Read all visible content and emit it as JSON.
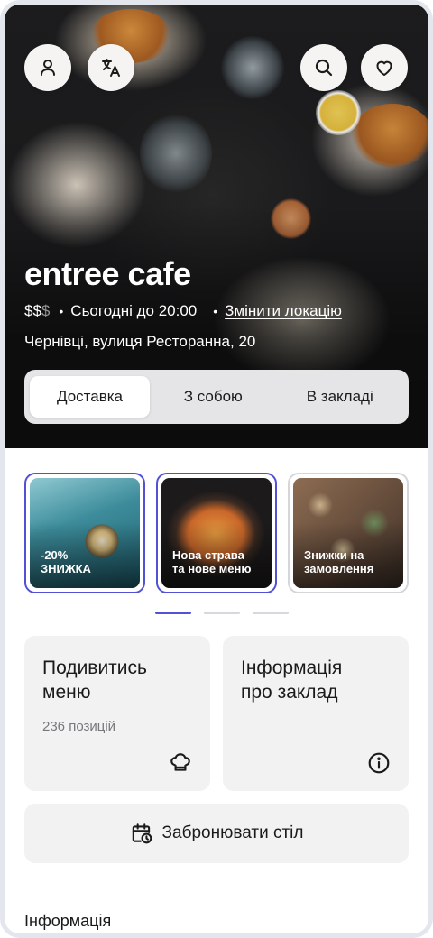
{
  "header": {
    "profile_icon": "user-icon",
    "translate_icon": "translate-icon",
    "search_icon": "search-icon",
    "favorite_icon": "heart-icon"
  },
  "restaurant": {
    "name": "entree cafe",
    "price_active": "$$",
    "price_inactive": "$",
    "hours": "Сьогодні до 20:00",
    "change_location": "Змінити локацію",
    "address": "Чернівці, вулиця Ресторанна, 20"
  },
  "order_modes": {
    "selected": "Доставка",
    "items": [
      "Доставка",
      "З собою",
      "В закладі"
    ]
  },
  "promos": [
    {
      "caption": "-20%\nЗНИЖКА",
      "selected": true
    },
    {
      "caption": "Нова страва\nта нове меню",
      "selected": true
    },
    {
      "caption": "Знижки на\nзамовлення",
      "selected": false
    }
  ],
  "pager": {
    "pages": 3,
    "current": 1
  },
  "tiles": {
    "menu": {
      "title": "Подивитись\nменю",
      "subtitle": "236 позицій",
      "icon": "chef-hat-icon"
    },
    "info": {
      "title": "Інформація\nпро заклад",
      "icon": "info-icon"
    }
  },
  "booking": {
    "label": "Забронювати стіл",
    "icon": "calendar-clock-icon"
  },
  "info_section": {
    "heading": "Інформація"
  },
  "colors": {
    "accent": "#5151d6",
    "tile_bg": "#f2f2f3",
    "divider": "#e2e2e5"
  }
}
